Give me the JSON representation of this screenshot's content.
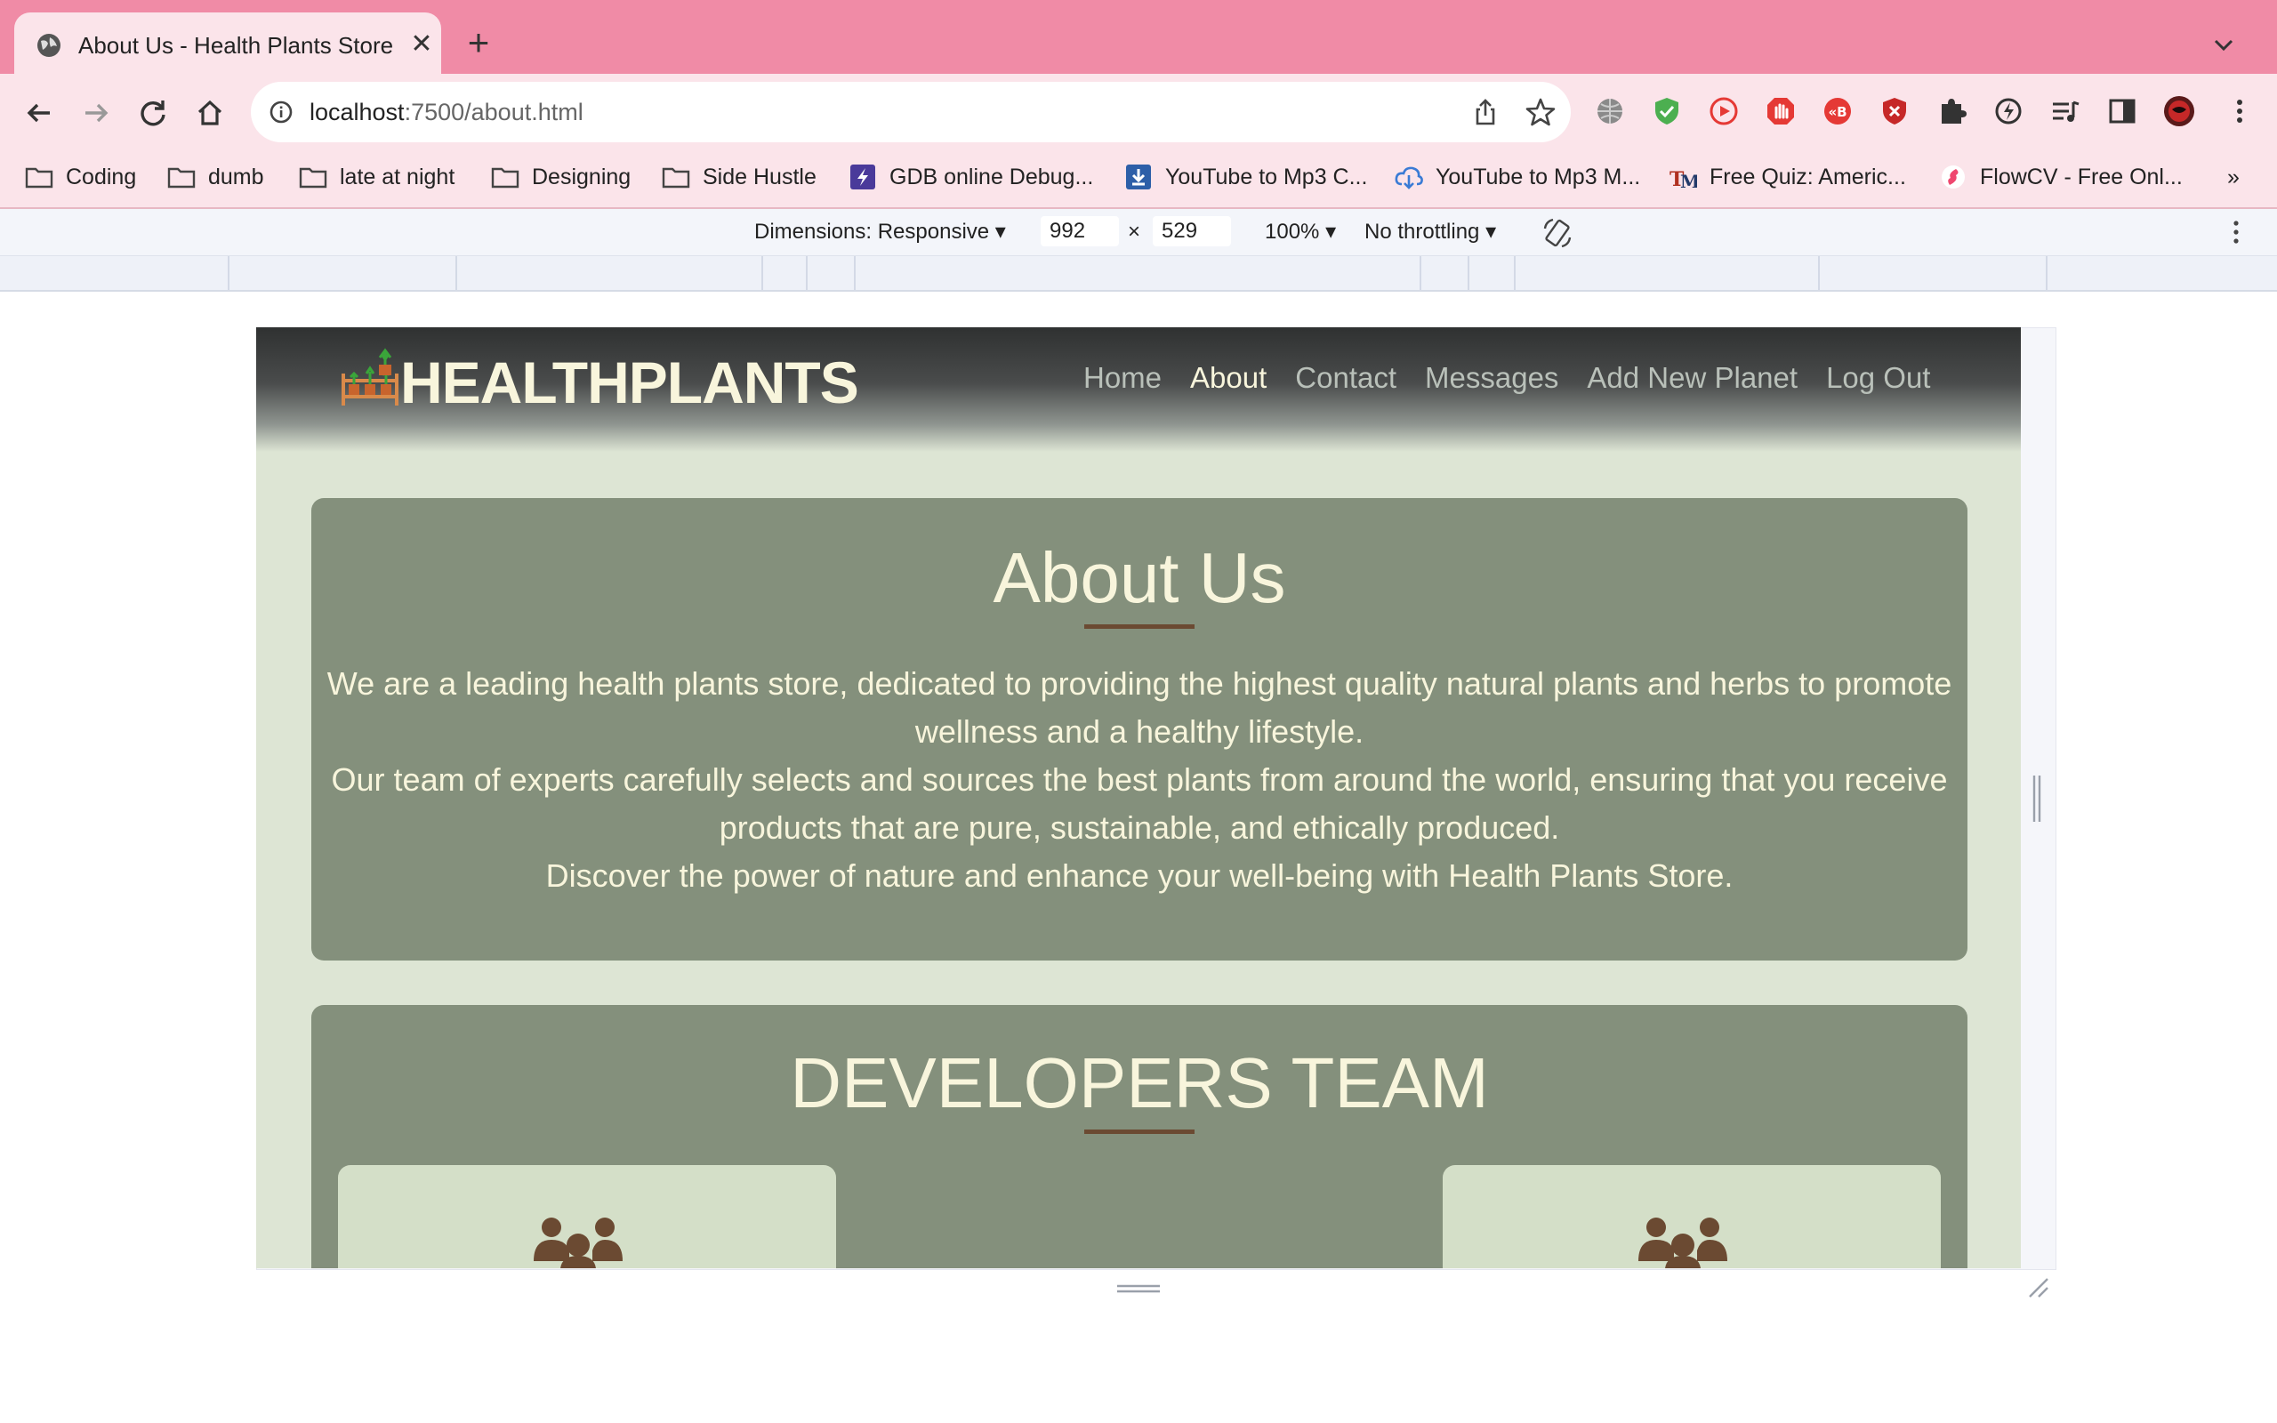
{
  "browser": {
    "tab": {
      "title": "About Us - Health Plants Store"
    },
    "address": {
      "host": "localhost",
      "path": ":7500/about.html"
    },
    "bookmarks": [
      {
        "label": "Coding",
        "icon": "folder-icon"
      },
      {
        "label": "dumb",
        "icon": "folder-icon"
      },
      {
        "label": "late at night",
        "icon": "folder-icon"
      },
      {
        "label": "Designing",
        "icon": "folder-icon"
      },
      {
        "label": "Side Hustle",
        "icon": "folder-icon"
      },
      {
        "label": "GDB online Debug...",
        "icon": "gdb-icon"
      },
      {
        "label": "YouTube to Mp3 C...",
        "icon": "download-icon"
      },
      {
        "label": "YouTube to Mp3 M...",
        "icon": "cloud-download-icon"
      },
      {
        "label": "Free Quiz: Americ...",
        "icon": "quiz-logo-icon"
      },
      {
        "label": "FlowCV - Free Onl...",
        "icon": "flowcv-icon"
      }
    ],
    "more_bookmarks": "»"
  },
  "devtools": {
    "dimensions_label": "Dimensions: Responsive",
    "width": "992",
    "times": "×",
    "height": "529",
    "zoom": "100%",
    "throttling": "No throttling"
  },
  "site": {
    "logo": "HEALTHPLANTS",
    "nav": [
      {
        "label": "Home",
        "active": false
      },
      {
        "label": "About",
        "active": true
      },
      {
        "label": "Contact",
        "active": false
      },
      {
        "label": "Messages",
        "active": false
      },
      {
        "label": "Add New Planet",
        "active": false
      },
      {
        "label": "Log Out",
        "active": false
      }
    ],
    "about": {
      "title": "About Us",
      "paragraphs": [
        "We are a leading health plants store, dedicated to providing the highest quality natural plants and herbs to promote wellness and a healthy lifestyle.",
        "Our team of experts carefully selects and sources the best plants from around the world, ensuring that you receive products that are pure, sustainable, and ethically produced.",
        "Discover the power of nature and enhance your well-being with Health Plants Store."
      ]
    },
    "developers": {
      "title": "DEVELOPERS TEAM"
    }
  },
  "colors": {
    "chrome_tabstrip": "#f08ba6",
    "chrome_toolbar": "#fbe4ea",
    "card": "#84907c",
    "page_bg": "#dde5d4",
    "cream_text": "#f8f5dc",
    "accent_rule": "#6b4a32"
  }
}
